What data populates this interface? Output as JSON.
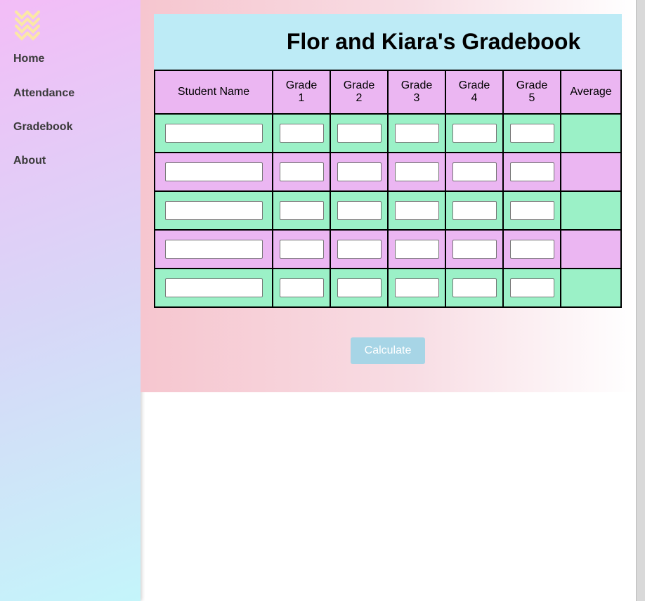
{
  "sidebar": {
    "logo_icon": "chevrons-down-logo",
    "items": [
      {
        "label": "Home"
      },
      {
        "label": "Attendance"
      },
      {
        "label": "Gradebook"
      },
      {
        "label": "About"
      }
    ]
  },
  "main": {
    "title": "Flor and Kiara's Gradebook",
    "table": {
      "headers": [
        "Student Name",
        "Grade 1",
        "Grade 2",
        "Grade 3",
        "Grade 4",
        "Grade 5",
        "Average"
      ],
      "rows": [
        {
          "name": "",
          "grades": [
            "",
            "",
            "",
            "",
            ""
          ],
          "average": ""
        },
        {
          "name": "",
          "grades": [
            "",
            "",
            "",
            "",
            ""
          ],
          "average": ""
        },
        {
          "name": "",
          "grades": [
            "",
            "",
            "",
            "",
            ""
          ],
          "average": ""
        },
        {
          "name": "",
          "grades": [
            "",
            "",
            "",
            "",
            ""
          ],
          "average": ""
        },
        {
          "name": "",
          "grades": [
            "",
            "",
            "",
            "",
            ""
          ],
          "average": ""
        }
      ]
    },
    "calculate_label": "Calculate"
  },
  "colors": {
    "title_bg": "#bdebf6",
    "row_green": "#9bf1c7",
    "row_pink": "#ebb6f2",
    "button_bg": "#a7d5e6",
    "logo": "#fbe8a6"
  }
}
